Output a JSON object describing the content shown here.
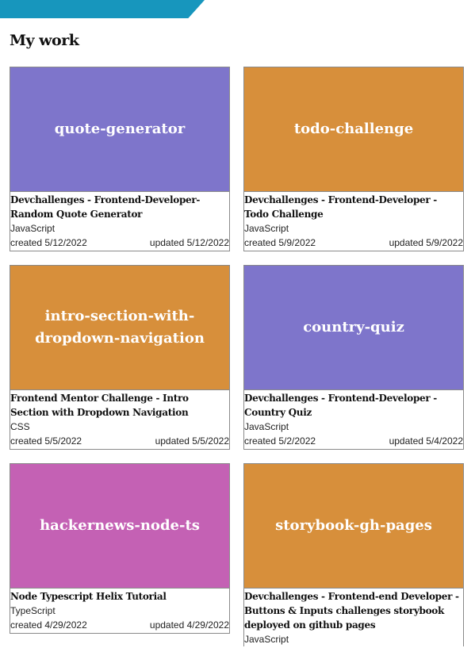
{
  "page": {
    "section_title": "My work"
  },
  "colors": {
    "banner": "#1796bd",
    "purple": "#7e75cb",
    "orange": "#d78f3b",
    "pink": "#c461b4"
  },
  "projects": [
    {
      "name": "quote-generator",
      "description": "Devchallenges - Frontend-Developer- Random Quote Generator",
      "language": "JavaScript",
      "created": "created 5/12/2022",
      "updated": "updated 5/12/2022"
    },
    {
      "name": "todo-challenge",
      "description": "Devchallenges - Frontend-Developer - Todo Challenge",
      "language": "JavaScript",
      "created": "created 5/9/2022",
      "updated": "updated 5/9/2022"
    },
    {
      "name": "intro-section-with-dropdown-navigation",
      "description": "Frontend Mentor Challenge - Intro Section with Dropdown Navigation",
      "language": "CSS",
      "created": "created 5/5/2022",
      "updated": "updated 5/5/2022"
    },
    {
      "name": "country-quiz",
      "description": "Devchallenges - Frontend-Developer - Country Quiz",
      "language": "JavaScript",
      "created": "created 5/2/2022",
      "updated": "updated 5/4/2022"
    },
    {
      "name": "hackernews-node-ts",
      "description": "Node Typescript Helix Tutorial",
      "language": "TypeScript",
      "created": "created 4/29/2022",
      "updated": "updated 4/29/2022"
    },
    {
      "name": "storybook-gh-pages",
      "description": "Devchallenges - Frontend-end Developer - Buttons & Inputs challenges storybook deployed on github pages",
      "language": "JavaScript"
    }
  ]
}
